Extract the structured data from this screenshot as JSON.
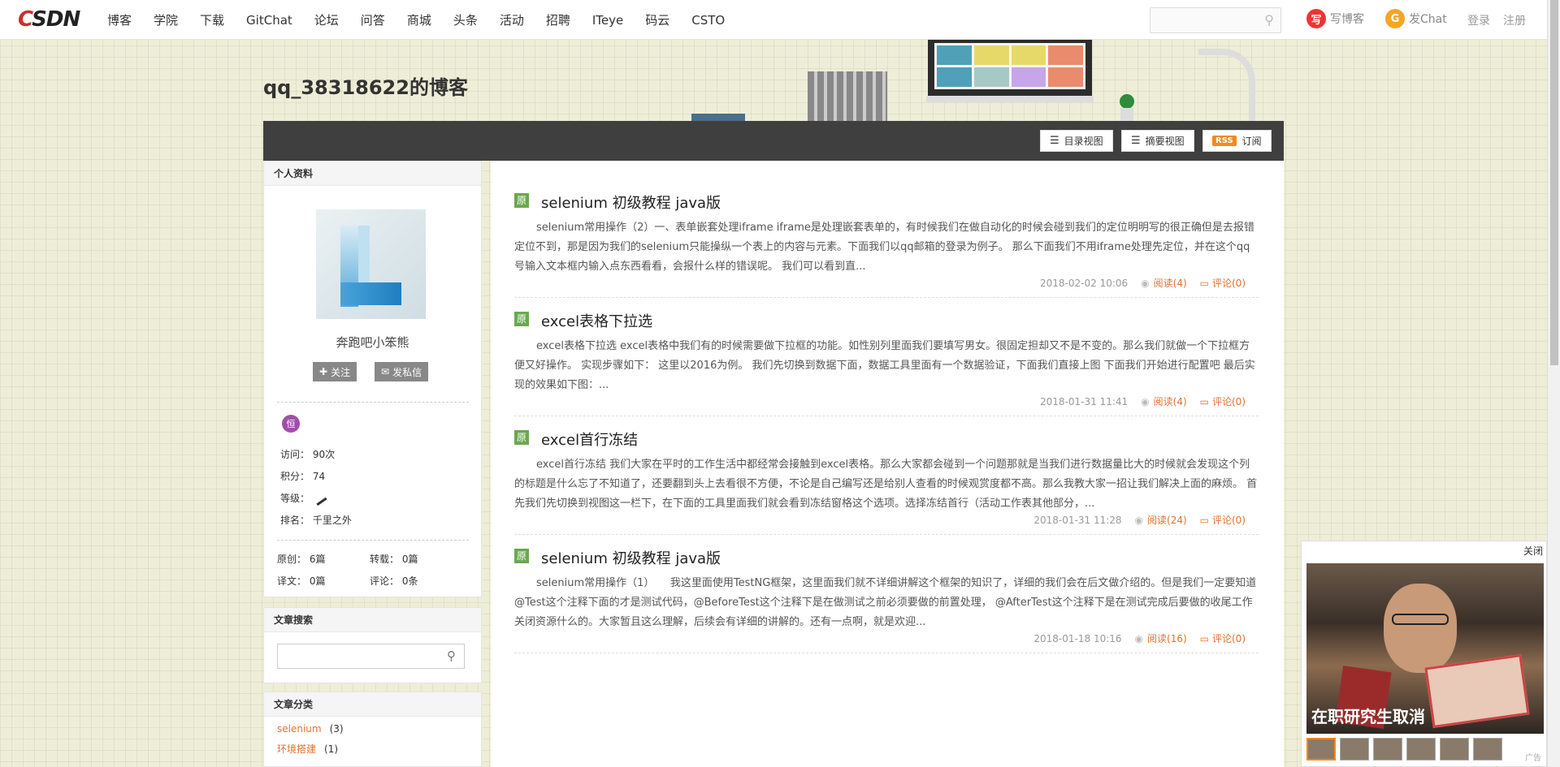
{
  "nav": {
    "logo_c": "C",
    "logo_sdn": "SDN",
    "items": [
      "博客",
      "学院",
      "下载",
      "GitChat",
      "论坛",
      "问答",
      "商城",
      "头条",
      "活动",
      "招聘",
      "ITeye",
      "码云",
      "CSTO"
    ],
    "search_icon": "search-icon",
    "write_blog": "写博客",
    "write_blog_icon": "写",
    "gitchat": "发Chat",
    "gitchat_icon": "G",
    "login": "登录",
    "register": "注册"
  },
  "blog": {
    "title": "qq_38318622的博客",
    "view_catalog": "目录视图",
    "view_summary": "摘要视图",
    "rss_badge": "RSS",
    "subscribe": "订阅"
  },
  "profile": {
    "heading": "个人资料",
    "username": "奔跑吧小笨熊",
    "follow": "关注",
    "message": "发私信",
    "medal": "恒",
    "visits_label": "访问：",
    "visits": "90次",
    "points_label": "积分：",
    "points": "74",
    "level_label": "等级：",
    "rank_label": "排名：",
    "rank": "千里之外",
    "original_label": "原创：",
    "original": "6篇",
    "repost_label": "转载：",
    "repost": "0篇",
    "translate_label": "译文：",
    "translate": "0篇",
    "comments_label": "评论：",
    "comments": "0条"
  },
  "search_box": {
    "heading": "文章搜索",
    "placeholder": ""
  },
  "categories": {
    "heading": "文章分类",
    "items": [
      {
        "name": "selenium",
        "count": "(3)"
      },
      {
        "name": "环境搭建",
        "count": "(1)"
      }
    ]
  },
  "articles": [
    {
      "tag": "原",
      "title": "selenium 初级教程 java版",
      "desc": "selenium常用操作（2）一、表单嵌套处理iframe iframe是处理嵌套表单的，有时候我们在做自动化的时候会碰到我们的定位明明写的很正确但是去报错定位不到，那是因为我们的selenium只能操纵一个表上的内容与元素。下面我们以qq邮箱的登录为例子。 那么下面我们不用iframe处理先定位，并在这个qq号输入文本框内输入点东西看看，会报什么样的错误呢。 我们可以看到直...",
      "date": "2018-02-02 10:06",
      "read": "阅读(4)",
      "comment": "评论(0)"
    },
    {
      "tag": "原",
      "title": "excel表格下拉选",
      "desc": "excel表格下拉选 excel表格中我们有的时候需要做下拉框的功能。如性别列里面我们要填写男女。很固定担却又不是不变的。那么我们就做一个下拉框方便又好操作。 实现步骤如下： 这里以2016为例。 我们先切换到数据下面，数据工具里面有一个数据验证，下面我们直接上图 下面我们开始进行配置吧 最后实现的效果如下图：...",
      "date": "2018-01-31 11:41",
      "read": "阅读(4)",
      "comment": "评论(0)"
    },
    {
      "tag": "原",
      "title": "excel首行冻结",
      "desc": "excel首行冻结 我们大家在平时的工作生活中都经常会接触到excel表格。那么大家都会碰到一个问题那就是当我们进行数据量比大的时候就会发现这个列的标题是什么忘了不知道了，还要翻到头上去看很不方便，不论是自己编写还是给别人查看的时候观赏度都不高。那么我教大家一招让我们解决上面的麻烦。 首先我们先切换到视图这一栏下，在下面的工具里面我们就会看到冻结窗格这个选项。选择冻结首行（活动工作表其他部分，...",
      "date": "2018-01-31 11:28",
      "read": "阅读(24)",
      "comment": "评论(0)"
    },
    {
      "tag": "原",
      "title": "selenium 初级教程 java版",
      "desc": "selenium常用操作（1）　　我这里面使用TestNG框架，这里面我们就不详细讲解这个框架的知识了，详细的我们会在后文做介绍的。但是我们一定要知道@Test这个注释下面的才是测试代码，@BeforeTest这个注释下是在做测试之前必须要做的前置处理， @AfterTest这个注释下是在测试完成后要做的收尾工作关闭资源什么的。大家暂且这么理解，后续会有详细的讲解的。还有一点啊，就是欢迎...",
      "date": "2018-01-18 10:16",
      "read": "阅读(16)",
      "comment": "评论(0)"
    }
  ],
  "ad": {
    "close": "关闭",
    "caption": "在职研究生取消",
    "label": "广告"
  }
}
